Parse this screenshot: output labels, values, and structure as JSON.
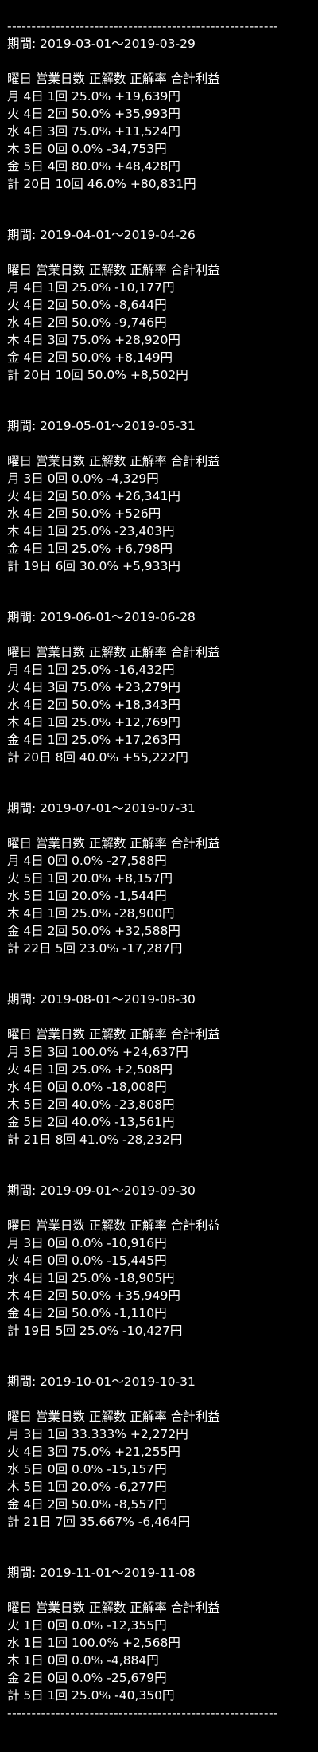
{
  "rule": "------------------------------------------------------------",
  "sections": [
    {
      "period": "期間: 2019-03-01～2019-03-29",
      "header": "曜日 営業日数 正解数 正解率 合計利益",
      "rows": [
        "月 4日 1回 25.0% +19,639円",
        "火 4日 2回 50.0% +35,993円",
        "水 4日 3回 75.0% +11,524円",
        "木 3日 0回 0.0% -34,753円",
        "金 5日 4回 80.0% +48,428円",
        "計 20日 10回 46.0% +80,831円"
      ]
    },
    {
      "period": "期間: 2019-04-01～2019-04-26",
      "header": "曜日 営業日数 正解数 正解率 合計利益",
      "rows": [
        "月 4日 1回 25.0% -10,177円",
        "火 4日 2回 50.0% -8,644円",
        "水 4日 2回 50.0% -9,746円",
        "木 4日 3回 75.0% +28,920円",
        "金 4日 2回 50.0% +8,149円",
        "計 20日 10回 50.0% +8,502円"
      ]
    },
    {
      "period": "期間: 2019-05-01～2019-05-31",
      "header": "曜日 営業日数 正解数 正解率 合計利益",
      "rows": [
        "月 3日 0回 0.0% -4,329円",
        "火 4日 2回 50.0% +26,341円",
        "水 4日 2回 50.0% +526円",
        "木 4日 1回 25.0% -23,403円",
        "金 4日 1回 25.0% +6,798円",
        "計 19日 6回 30.0% +5,933円"
      ]
    },
    {
      "period": "期間: 2019-06-01～2019-06-28",
      "header": "曜日 営業日数 正解数 正解率 合計利益",
      "rows": [
        "月 4日 1回 25.0% -16,432円",
        "火 4日 3回 75.0% +23,279円",
        "水 4日 2回 50.0% +18,343円",
        "木 4日 1回 25.0% +12,769円",
        "金 4日 1回 25.0% +17,263円",
        "計 20日 8回 40.0% +55,222円"
      ]
    },
    {
      "period": "期間: 2019-07-01～2019-07-31",
      "header": "曜日 営業日数 正解数 正解率 合計利益",
      "rows": [
        "月 4日 0回 0.0% -27,588円",
        "火 5日 1回 20.0% +8,157円",
        "水 5日 1回 20.0% -1,544円",
        "木 4日 1回 25.0% -28,900円",
        "金 4日 2回 50.0% +32,588円",
        "計 22日 5回 23.0% -17,287円"
      ]
    },
    {
      "period": "期間: 2019-08-01～2019-08-30",
      "header": "曜日 営業日数 正解数 正解率 合計利益",
      "rows": [
        "月 3日 3回 100.0% +24,637円",
        "火 4日 1回 25.0% +2,508円",
        "水 4日 0回 0.0% -18,008円",
        "木 5日 2回 40.0% -23,808円",
        "金 5日 2回 40.0% -13,561円",
        "計 21日 8回 41.0% -28,232円"
      ]
    },
    {
      "period": "期間: 2019-09-01～2019-09-30",
      "header": "曜日 営業日数 正解数 正解率 合計利益",
      "rows": [
        "月 3日 0回 0.0% -10,916円",
        "火 4日 0回 0.0% -15,445円",
        "水 4日 1回 25.0% -18,905円",
        "木 4日 2回 50.0% +35,949円",
        "金 4日 2回 50.0% -1,110円",
        "計 19日 5回 25.0% -10,427円"
      ]
    },
    {
      "period": "期間: 2019-10-01～2019-10-31",
      "header": "曜日 営業日数 正解数 正解率 合計利益",
      "rows": [
        "月 3日 1回 33.333% +2,272円",
        "火 4日 3回 75.0% +21,255円",
        "水 5日 0回 0.0% -15,157円",
        "木 5日 1回 20.0% -6,277円",
        "金 4日 2回 50.0% -8,557円",
        "計 21日 7回 35.667% -6,464円"
      ]
    },
    {
      "period": "期間: 2019-11-01～2019-11-08",
      "header": "曜日 営業日数 正解数 正解率 合計利益",
      "rows": [
        "火 1日 0回 0.0% -12,355円",
        "水 1日 1回 100.0% +2,568円",
        "木 1日 0回 0.0% -4,884円",
        "金 2日 0回 0.0% -25,679円",
        "計 5日 1回 25.0% -40,350円"
      ]
    }
  ]
}
